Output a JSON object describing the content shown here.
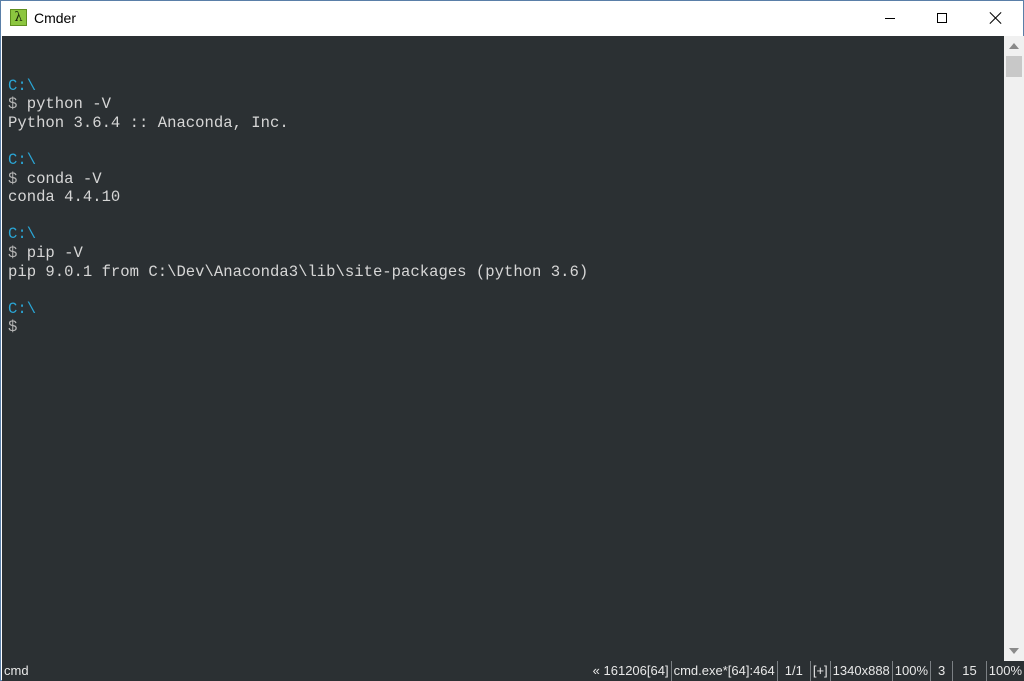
{
  "window": {
    "title": "Cmder",
    "icon_glyph": "λ"
  },
  "terminal": {
    "lines": [
      {
        "type": "blank",
        "text": ""
      },
      {
        "type": "path",
        "text": "C:\\"
      },
      {
        "type": "command",
        "prompt": "$",
        "text": " python -V"
      },
      {
        "type": "output",
        "text": "Python 3.6.4 :: Anaconda, Inc."
      },
      {
        "type": "blank",
        "text": ""
      },
      {
        "type": "path",
        "text": "C:\\"
      },
      {
        "type": "command",
        "prompt": "$",
        "text": " conda -V"
      },
      {
        "type": "output",
        "text": "conda 4.4.10"
      },
      {
        "type": "blank",
        "text": ""
      },
      {
        "type": "path",
        "text": "C:\\"
      },
      {
        "type": "command",
        "prompt": "$",
        "text": " pip -V"
      },
      {
        "type": "output",
        "text": "pip 9.0.1 from C:\\Dev\\Anaconda3\\lib\\site-packages (python 3.6)"
      },
      {
        "type": "blank",
        "text": ""
      },
      {
        "type": "path",
        "text": "C:\\"
      },
      {
        "type": "command",
        "prompt": "$",
        "text": ""
      }
    ]
  },
  "statusbar": {
    "left": "cmd",
    "cells": [
      "« 161206[64]",
      "cmd.exe*[64]:464",
      "1/1",
      "[+]",
      "1340x888",
      "100%",
      "3",
      "15",
      "100%"
    ]
  },
  "colors": {
    "terminal_bg": "#2b3033",
    "prompt_path": "#2aa6d6",
    "text": "#d6d6d6",
    "icon_green": "#8cc63f"
  }
}
